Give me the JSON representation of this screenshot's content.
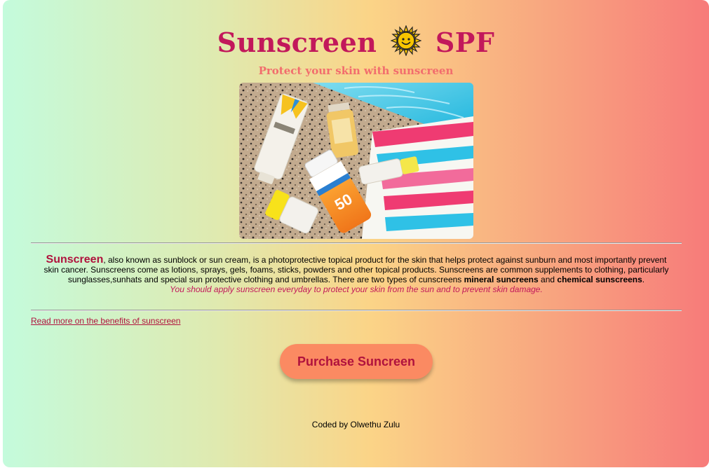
{
  "header": {
    "title_left": "Sunscreen",
    "title_right": "SPF",
    "title_icon": "sun-face-emoji",
    "subtitle": "Protect your skin with sunscreen"
  },
  "hero": {
    "description": "sunscreen bottles and towel by a pool",
    "product_label": "50"
  },
  "article": {
    "lead": "Sunscreen",
    "text1": ", also known as sunblock or sun cream, is a photoprotective topical product for the skin that helps protect against sunburn and most importantly prevent skin cancer. Sunscreens come as lotions, sprays, gels, foams, sticks, powders and other topical products. Sunscreens are common supplements to clothing, particularly sunglasses,sunhats and special sun protective clothing and umbrellas. There are two types of cunscreens ",
    "bold1": "mineral suncreens",
    "text2": " and ",
    "bold2": "chemical sunscreens",
    "text3": ".",
    "tip": "You should apply sunscreen everyday to protect your skin from the sun and to prevent skin damage."
  },
  "link": {
    "label": "Read more on the benefits of sunscreen"
  },
  "cta": {
    "label": "Purchase Suncreen"
  },
  "footer": {
    "credit": "Coded by Olwethu Zulu"
  },
  "colors": {
    "accent": "#c2185b",
    "subtitle": "#f26d6d",
    "button": "#fb8a62"
  }
}
